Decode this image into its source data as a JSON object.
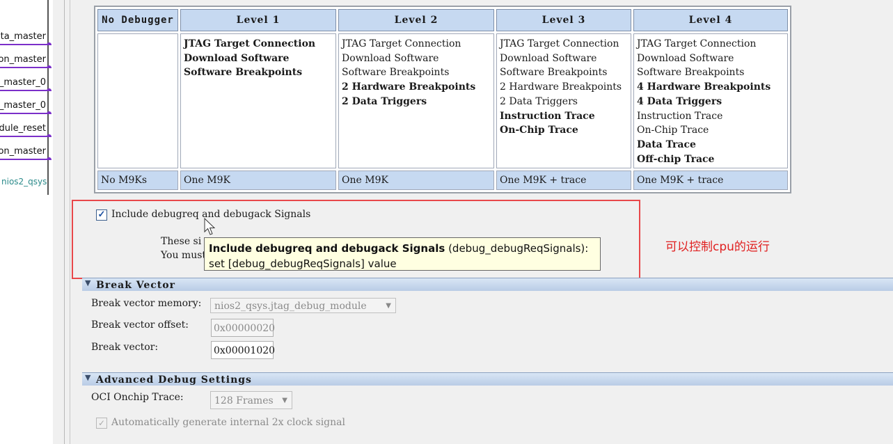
{
  "left_panel": {
    "ports": [
      "ata_master",
      "ion_master",
      "_master_0",
      "_master_0",
      "dule_reset",
      "ion_master"
    ],
    "component_label": "nios2_qsys"
  },
  "debug_table": {
    "headers": [
      "No Debugger",
      "Level 1",
      "Level 2",
      "Level 3",
      "Level 4"
    ],
    "columns": [
      [],
      [
        {
          "text": "JTAG Target Connection",
          "bold": true
        },
        {
          "text": "Download Software",
          "bold": true
        },
        {
          "text": "Software Breakpoints",
          "bold": true
        }
      ],
      [
        {
          "text": "JTAG Target Connection",
          "bold": false
        },
        {
          "text": "Download Software",
          "bold": false
        },
        {
          "text": "Software Breakpoints",
          "bold": false
        },
        {
          "text": "2 Hardware Breakpoints",
          "bold": true
        },
        {
          "text": "2 Data Triggers",
          "bold": true
        }
      ],
      [
        {
          "text": "JTAG Target Connection",
          "bold": false
        },
        {
          "text": "Download Software",
          "bold": false
        },
        {
          "text": "Software Breakpoints",
          "bold": false
        },
        {
          "text": "2 Hardware Breakpoints",
          "bold": false
        },
        {
          "text": "2 Data Triggers",
          "bold": false
        },
        {
          "text": "Instruction Trace",
          "bold": true
        },
        {
          "text": "On-Chip Trace",
          "bold": true
        }
      ],
      [
        {
          "text": "JTAG Target Connection",
          "bold": false
        },
        {
          "text": "Download Software",
          "bold": false
        },
        {
          "text": "Software Breakpoints",
          "bold": false
        },
        {
          "text": "4 Hardware Breakpoints",
          "bold": true
        },
        {
          "text": "4 Data Triggers",
          "bold": true
        },
        {
          "text": "Instruction Trace",
          "bold": false
        },
        {
          "text": "On-Chip Trace",
          "bold": false
        },
        {
          "text": "Data Trace",
          "bold": true
        },
        {
          "text": "Off-chip Trace",
          "bold": true
        }
      ]
    ],
    "footer": [
      "No M9Ks",
      "One M9K",
      "One M9K",
      "One M9K + trace",
      "One M9K + trace"
    ]
  },
  "debugreq": {
    "label": "Include debugreq and debugack Signals",
    "checked": true,
    "note_line1": "These si",
    "note_line2": "You must"
  },
  "tooltip": {
    "title": "Include debugreq and debugack Signals",
    "param": "(debug_debugReqSignals):",
    "line2": "set [debug_debugReqSignals] value"
  },
  "annotation": "可以控制cpu的运行",
  "break_vector": {
    "section_title": "Break Vector",
    "memory_label": "Break vector memory:",
    "memory_value": "nios2_qsys.jtag_debug_module",
    "offset_label": "Break vector offset:",
    "offset_value": "0x00000020",
    "vector_label": "Break vector:",
    "vector_value": "0x00001020"
  },
  "advanced_debug": {
    "section_title": "Advanced Debug Settings",
    "oci_label": "OCI Onchip Trace:",
    "oci_value": "128 Frames",
    "auto_clock_label": "Automatically generate internal 2x clock signal",
    "auto_clock_checked": true
  },
  "colors": {
    "header_bg": "#c6d9f1",
    "annotation": "#e02020",
    "highlight_border": "#e8474a",
    "port_wire": "#7b2fc9",
    "tooltip_bg": "#ffffe1"
  }
}
